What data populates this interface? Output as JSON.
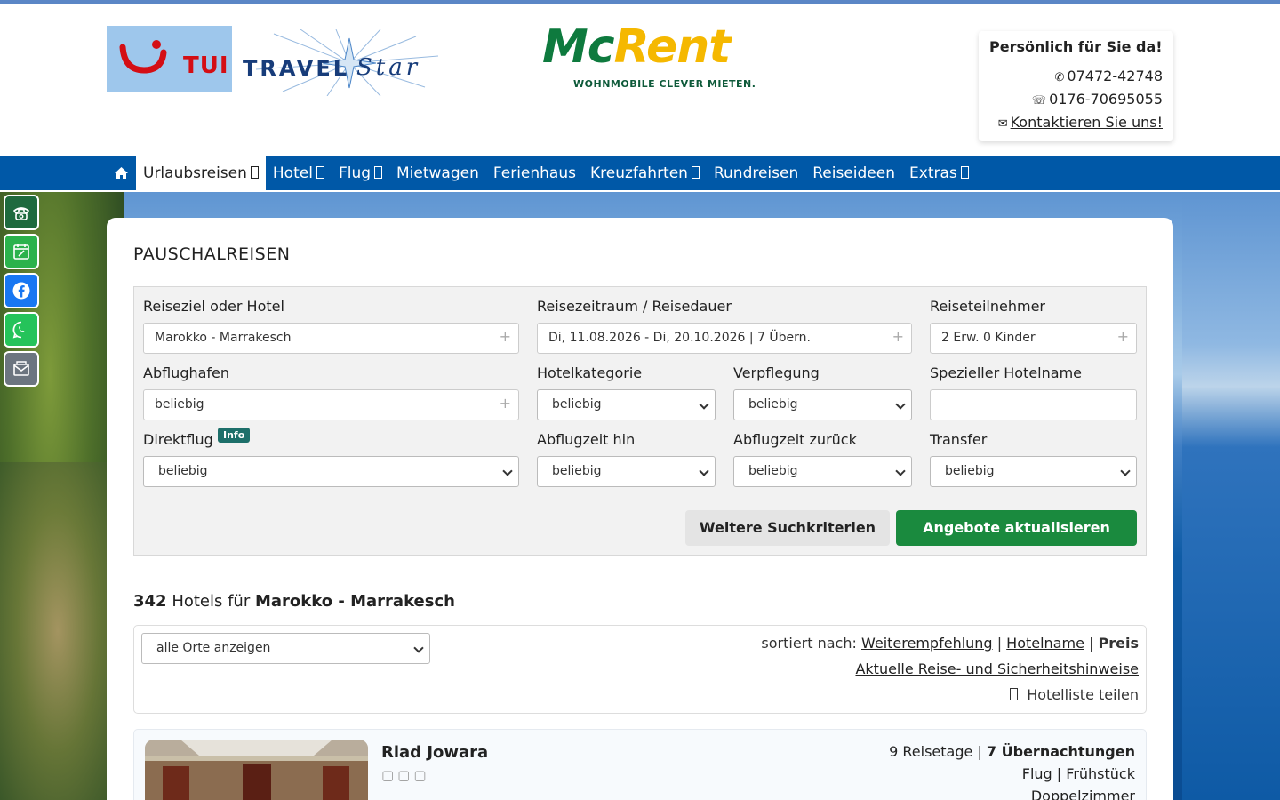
{
  "brand": {
    "tui": "TUI",
    "travelstar_a": "TRAVEL",
    "travelstar_b": "Star",
    "mcrent_a": "Mc",
    "mcrent_b": "Rent",
    "mcrent_tag": "WOHNMOBILE CLEVER MIETEN."
  },
  "contact": {
    "title": "Persönlich für Sie da!",
    "phone": "07472-42748",
    "whatsapp": "0176-70695055",
    "link": "Kontaktieren Sie uns!"
  },
  "nav": {
    "items": [
      {
        "label": "Urlaubsreisen"
      },
      {
        "label": "Hotel"
      },
      {
        "label": "Flug"
      },
      {
        "label": "Mietwagen"
      },
      {
        "label": "Ferienhaus"
      },
      {
        "label": "Kreuzfahrten"
      },
      {
        "label": "Rundreisen"
      },
      {
        "label": "Reiseideen"
      },
      {
        "label": "Extras"
      }
    ]
  },
  "colors": {
    "nav": "#0058a7",
    "primary_button": "#1a8a3e",
    "info_badge": "#1d6f6a"
  },
  "search": {
    "heading": "PAUSCHALREISEN",
    "destination_label": "Reiseziel oder Hotel",
    "destination_value": "Marokko - Marrakesch",
    "period_label": "Reisezeitraum / Reisedauer",
    "period_value": "Di, 11.08.2026 - Di, 20.10.2026 | 7 Übern.",
    "travellers_label": "Reiseteilnehmer",
    "travellers_value": "2 Erw. 0 Kinder",
    "airport_label": "Abflughafen",
    "airport_value": "beliebig",
    "category_label": "Hotelkategorie",
    "category_value": "beliebig",
    "board_label": "Verpflegung",
    "board_value": "beliebig",
    "hotelname_label": "Spezieller Hotelname",
    "hotelname_value": "",
    "direct_label": "Direktflug",
    "direct_badge": "Info",
    "direct_value": "beliebig",
    "deptime_label": "Abflugzeit hin",
    "deptime_value": "beliebig",
    "rettime_label": "Abflugzeit zurück",
    "rettime_value": "beliebig",
    "transfer_label": "Transfer",
    "transfer_value": "beliebig",
    "more_button": "Weitere Suchkriterien",
    "update_button": "Angebote aktualisieren"
  },
  "results": {
    "count": "342",
    "text": "Hotels für",
    "destination": "Marokko - Marrakesch",
    "location_filter": "alle Orte anzeigen",
    "sort_prefix": "sortiert nach:",
    "sort_recommend": "Weiterempfehlung",
    "sort_name": "Hotelname",
    "sort_price": "Preis",
    "separator": "|",
    "hinweis": "Aktuelle Reise- und Sicherheitshinweise",
    "share": "Hotelliste teilen"
  },
  "hotel": {
    "name": "Riad Jowara",
    "days": "9 Reisetage",
    "nights": "7 Übernachtungen",
    "travel_type": "Flug",
    "board": "Frühstück",
    "room": "Doppelzimmer",
    "separator": "|"
  }
}
